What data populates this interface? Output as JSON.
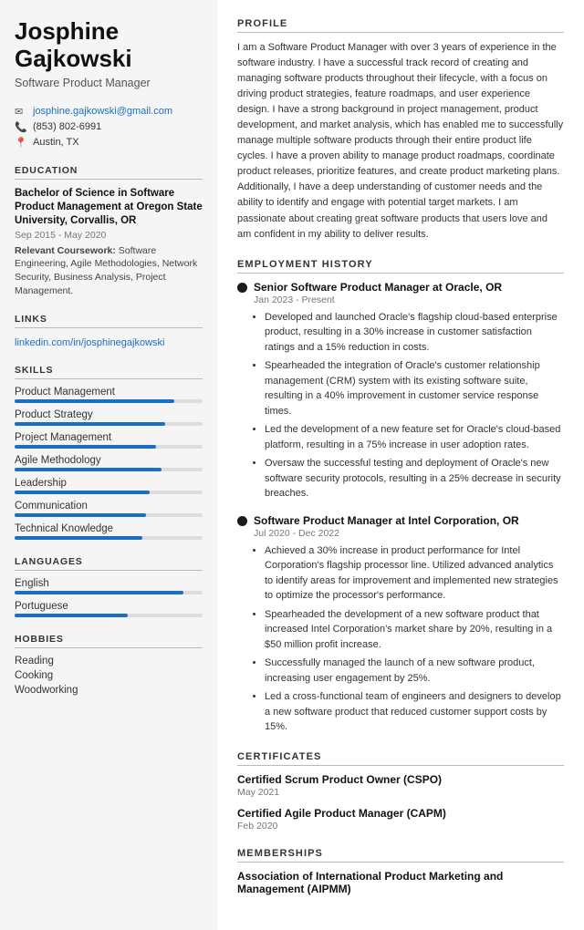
{
  "sidebar": {
    "name": "Josphine Gajkowski",
    "name_line1": "Josphine",
    "name_line2": "Gajkowski",
    "job_title": "Software Product Manager",
    "contact": {
      "email": "josphine.gajkowski@gmail.com",
      "phone": "(853) 802-6991",
      "location": "Austin, TX"
    },
    "education_title": "EDUCATION",
    "education": {
      "degree": "Bachelor of Science in Software Product Management at Oregon State University, Corvallis, OR",
      "period": "Sep 2015 - May 2020",
      "coursework_label": "Relevant Coursework:",
      "coursework": "Software Engineering, Agile Methodologies, Network Security, Business Analysis, Project Management."
    },
    "links_title": "LINKS",
    "links": [
      {
        "label": "linkedin.com/in/josphinegajkowski",
        "url": "linkedin.com/in/josphinegajkowski"
      }
    ],
    "skills_title": "SKILLS",
    "skills": [
      {
        "label": "Product Management",
        "pct": 85
      },
      {
        "label": "Product Strategy",
        "pct": 80
      },
      {
        "label": "Project Management",
        "pct": 75
      },
      {
        "label": "Agile Methodology",
        "pct": 78
      },
      {
        "label": "Leadership",
        "pct": 72
      },
      {
        "label": "Communication",
        "pct": 70
      },
      {
        "label": "Technical Knowledge",
        "pct": 68
      }
    ],
    "languages_title": "LANGUAGES",
    "languages": [
      {
        "label": "English",
        "pct": 90
      },
      {
        "label": "Portuguese",
        "pct": 60
      }
    ],
    "hobbies_title": "HOBBIES",
    "hobbies": [
      "Reading",
      "Cooking",
      "Woodworking"
    ]
  },
  "main": {
    "profile_title": "PROFILE",
    "profile_text": "I am a Software Product Manager with over 3 years of experience in the software industry. I have a successful track record of creating and managing software products throughout their lifecycle, with a focus on driving product strategies, feature roadmaps, and user experience design. I have a strong background in project management, product development, and market analysis, which has enabled me to successfully manage multiple software products through their entire product life cycles. I have a proven ability to manage product roadmaps, coordinate product releases, prioritize features, and create product marketing plans. Additionally, I have a deep understanding of customer needs and the ability to identify and engage with potential target markets. I am passionate about creating great software products that users love and am confident in my ability to deliver results.",
    "employment_title": "EMPLOYMENT HISTORY",
    "employment": [
      {
        "title": "Senior Software Product Manager at Oracle, OR",
        "period": "Jan 2023 - Present",
        "bullets": [
          "Developed and launched Oracle's flagship cloud-based enterprise product, resulting in a 30% increase in customer satisfaction ratings and a 15% reduction in costs.",
          "Spearheaded the integration of Oracle's customer relationship management (CRM) system with its existing software suite, resulting in a 40% improvement in customer service response times.",
          "Led the development of a new feature set for Oracle's cloud-based platform, resulting in a 75% increase in user adoption rates.",
          "Oversaw the successful testing and deployment of Oracle's new software security protocols, resulting in a 25% decrease in security breaches."
        ]
      },
      {
        "title": "Software Product Manager at Intel Corporation, OR",
        "period": "Jul 2020 - Dec 2022",
        "bullets": [
          "Achieved a 30% increase in product performance for Intel Corporation's flagship processor line. Utilized advanced analytics to identify areas for improvement and implemented new strategies to optimize the processor's performance.",
          "Spearheaded the development of a new software product that increased Intel Corporation's market share by 20%, resulting in a $50 million profit increase.",
          "Successfully managed the launch of a new software product, increasing user engagement by 25%.",
          "Led a cross-functional team of engineers and designers to develop a new software product that reduced customer support costs by 15%."
        ]
      }
    ],
    "certificates_title": "CERTIFICATES",
    "certificates": [
      {
        "title": "Certified Scrum Product Owner (CSPO)",
        "date": "May 2021"
      },
      {
        "title": "Certified Agile Product Manager (CAPM)",
        "date": "Feb 2020"
      }
    ],
    "memberships_title": "MEMBERSHIPS",
    "memberships": [
      {
        "title": "Association of International Product Marketing and Management (AIPMM)"
      }
    ]
  }
}
